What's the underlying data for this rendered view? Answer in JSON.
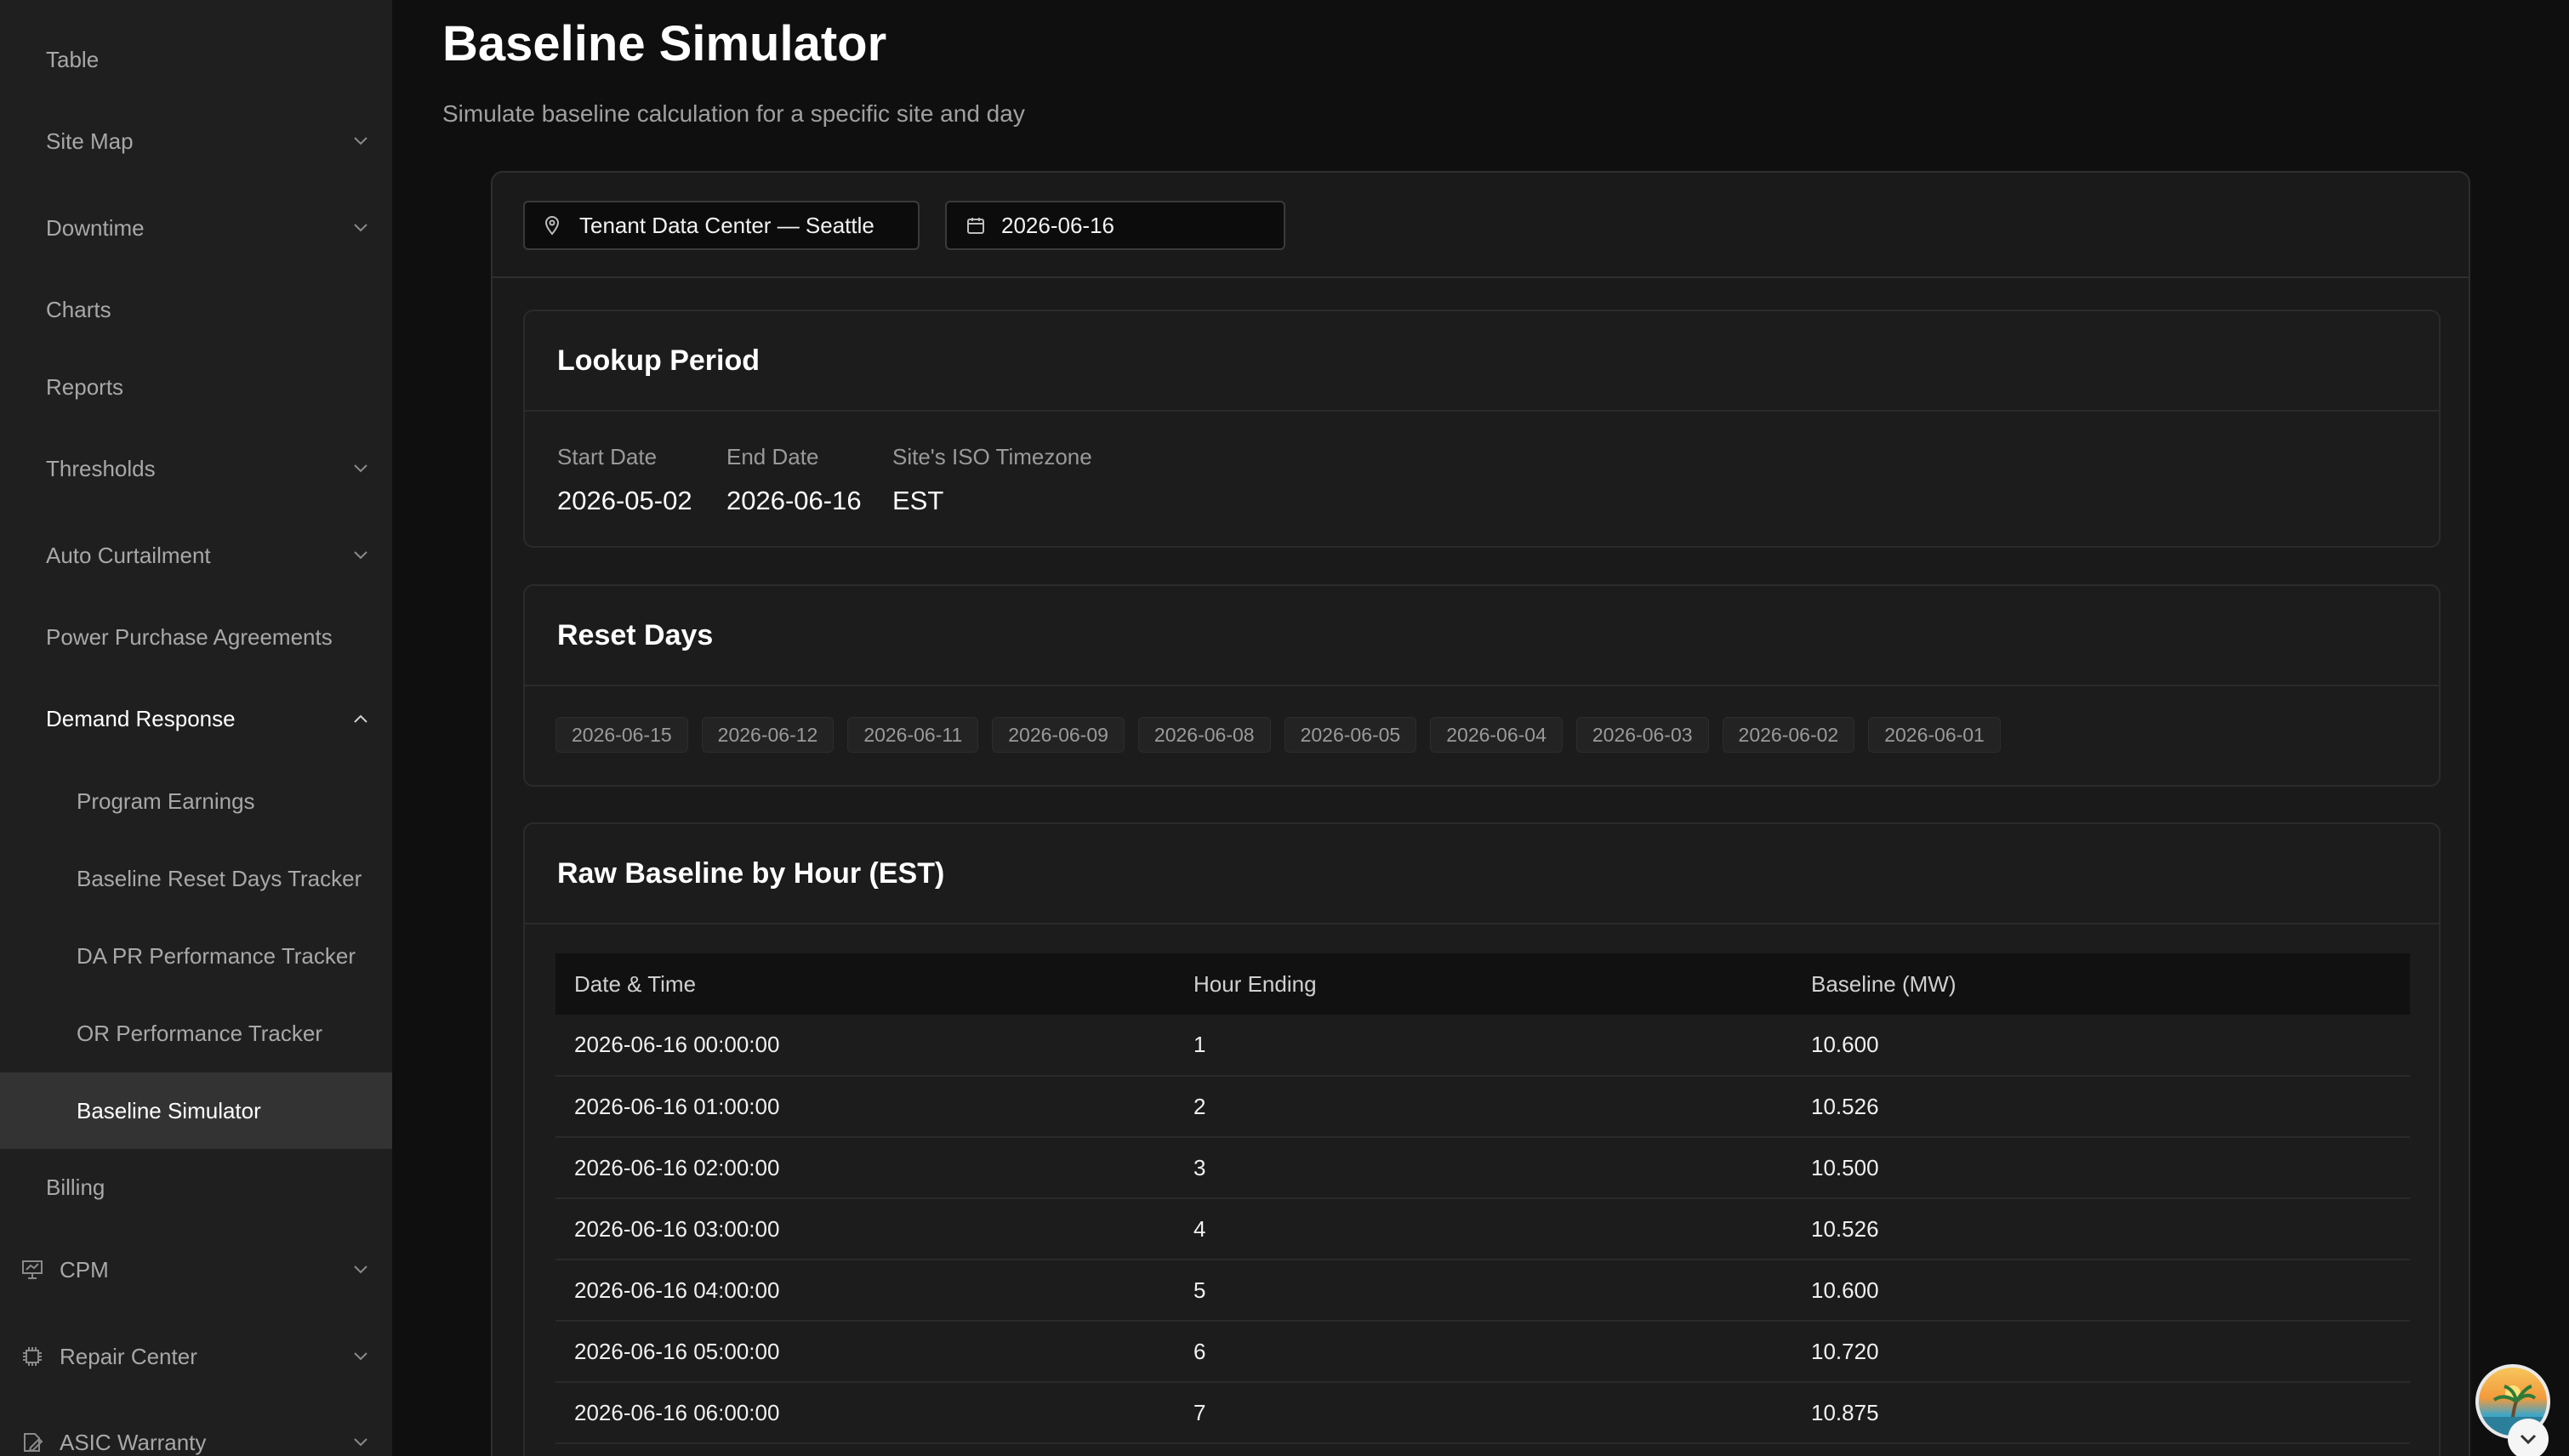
{
  "sidebar": {
    "items": [
      {
        "label": "Table"
      },
      {
        "label": "Site Map"
      },
      {
        "label": "Downtime"
      },
      {
        "label": "Charts"
      },
      {
        "label": "Reports"
      },
      {
        "label": "Thresholds"
      },
      {
        "label": "Auto Curtailment"
      },
      {
        "label": "Power Purchase Agreements"
      },
      {
        "label": "Demand Response"
      },
      {
        "label": "Program Earnings"
      },
      {
        "label": "Baseline Reset Days Tracker"
      },
      {
        "label": "DA PR Performance Tracker"
      },
      {
        "label": "OR Performance Tracker"
      },
      {
        "label": "Baseline Simulator"
      },
      {
        "label": "Billing"
      },
      {
        "label": "CPM"
      },
      {
        "label": "Repair Center"
      },
      {
        "label": "ASIC Warranty"
      }
    ]
  },
  "page": {
    "title": "Baseline Simulator",
    "subtitle": "Simulate baseline calculation for a specific site and day"
  },
  "filters": {
    "site": "Tenant Data Center — Seattle",
    "date": "2026-06-16"
  },
  "lookup": {
    "title": "Lookup Period",
    "start_label": "Start Date",
    "start_value": "2026-05-02",
    "end_label": "End Date",
    "end_value": "2026-06-16",
    "tz_label": "Site's ISO Timezone",
    "tz_value": "EST"
  },
  "reset_days": {
    "title": "Reset Days",
    "days": [
      "2026-06-15",
      "2026-06-12",
      "2026-06-11",
      "2026-06-09",
      "2026-06-08",
      "2026-06-05",
      "2026-06-04",
      "2026-06-03",
      "2026-06-02",
      "2026-06-01"
    ]
  },
  "raw_baseline": {
    "title": "Raw Baseline by Hour (EST)",
    "headers": [
      "Date & Time",
      "Hour Ending",
      "Baseline (MW)"
    ],
    "rows": [
      [
        "2026-06-16 00:00:00",
        "1",
        "10.600"
      ],
      [
        "2026-06-16 01:00:00",
        "2",
        "10.526"
      ],
      [
        "2026-06-16 02:00:00",
        "3",
        "10.500"
      ],
      [
        "2026-06-16 03:00:00",
        "4",
        "10.526"
      ],
      [
        "2026-06-16 04:00:00",
        "5",
        "10.600"
      ],
      [
        "2026-06-16 05:00:00",
        "6",
        "10.720"
      ],
      [
        "2026-06-16 06:00:00",
        "7",
        "10.875"
      ]
    ]
  },
  "icons": {
    "chevron": "chevron-down-icon",
    "site": "map-pin-icon",
    "date": "calendar-icon",
    "cpm": "chart-board-icon",
    "repair": "chip-icon",
    "asic": "document-edit-icon"
  },
  "colors": {
    "background": "#0f0f0f",
    "sidebar": "#1f1f1f",
    "active_item": "#333333",
    "card": "#1c1c1c"
  }
}
